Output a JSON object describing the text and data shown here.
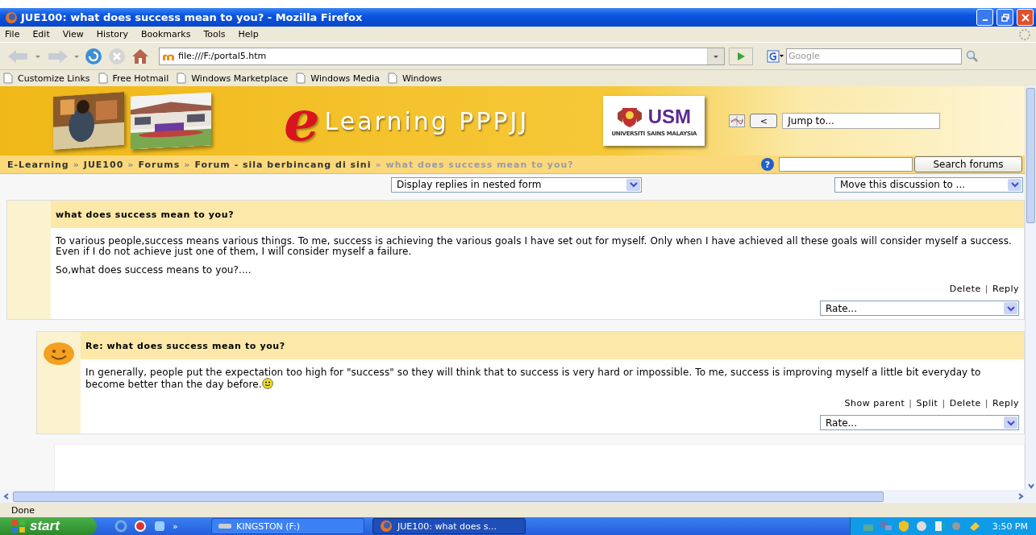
{
  "window": {
    "title": "JUE100: what does success mean to you? - Mozilla Firefox"
  },
  "menu": [
    "File",
    "Edit",
    "View",
    "History",
    "Bookmarks",
    "Tools",
    "Help"
  ],
  "address": {
    "value": "file:///F:/portal5.htm"
  },
  "web_search": {
    "placeholder": "Google"
  },
  "bookmarks": [
    "Customize Links",
    "Free Hotmail",
    "Windows Marketplace",
    "Windows Media",
    "Windows"
  ],
  "banner": {
    "logo_letter": "e",
    "title": "Learning PPPJJ",
    "university_logo": "USM",
    "university_name": "UNIVERSITI SAINS MALAYSIA",
    "prev_button": "<",
    "jump_to": "Jump to..."
  },
  "breadcrumb": [
    {
      "label": "E-Learning",
      "current": false
    },
    {
      "label": "JUE100",
      "current": false
    },
    {
      "label": "Forums",
      "current": false
    },
    {
      "label": "Forum - sila berbincang di sini",
      "current": false
    },
    {
      "label": "what does success mean to you?",
      "current": true
    }
  ],
  "breadcrumb_separator": "»",
  "help_icon": "?",
  "action_separator": "|",
  "search_forums": {
    "button": "Search forums"
  },
  "display_mode": {
    "value": "Display replies in nested form"
  },
  "move_discussion": {
    "value": "Move this discussion to ..."
  },
  "posts": [
    {
      "kind": "post",
      "subject": "what does success mean to you?",
      "paragraphs": [
        {
          "text": "To various people,success means various things. To me, success is achieving the various goals I have set out for myself. Only when I have achieved all these goals will consider myself a success. Even if I do not achieve just one of them, I will consider myself a failure.",
          "smiley": false
        },
        {
          "text": "So,what does success means to you?....",
          "smiley": false
        }
      ],
      "actions": [
        "Delete",
        "Reply"
      ],
      "rate": "Rate..."
    },
    {
      "kind": "reply",
      "subject": "Re: what does success mean to you?",
      "paragraphs": [
        {
          "text": "In generally, people put the expectation too high for \"success\" so they will think that to success is very hard or impossible. To me, success is improving myself a little bit everyday to become better than the day before.",
          "smiley": true
        }
      ],
      "actions": [
        "Show parent",
        "Split",
        "Delete",
        "Reply"
      ],
      "rate": "Rate..."
    }
  ],
  "status_bar": {
    "text": "Done"
  },
  "taskbar": {
    "start": "start",
    "more": "»",
    "tasks": [
      {
        "label": "KINGSTON (F:)",
        "selected": false
      },
      {
        "label": "JUE100: what does s...",
        "selected": true
      }
    ],
    "clock": "3:50 PM"
  }
}
